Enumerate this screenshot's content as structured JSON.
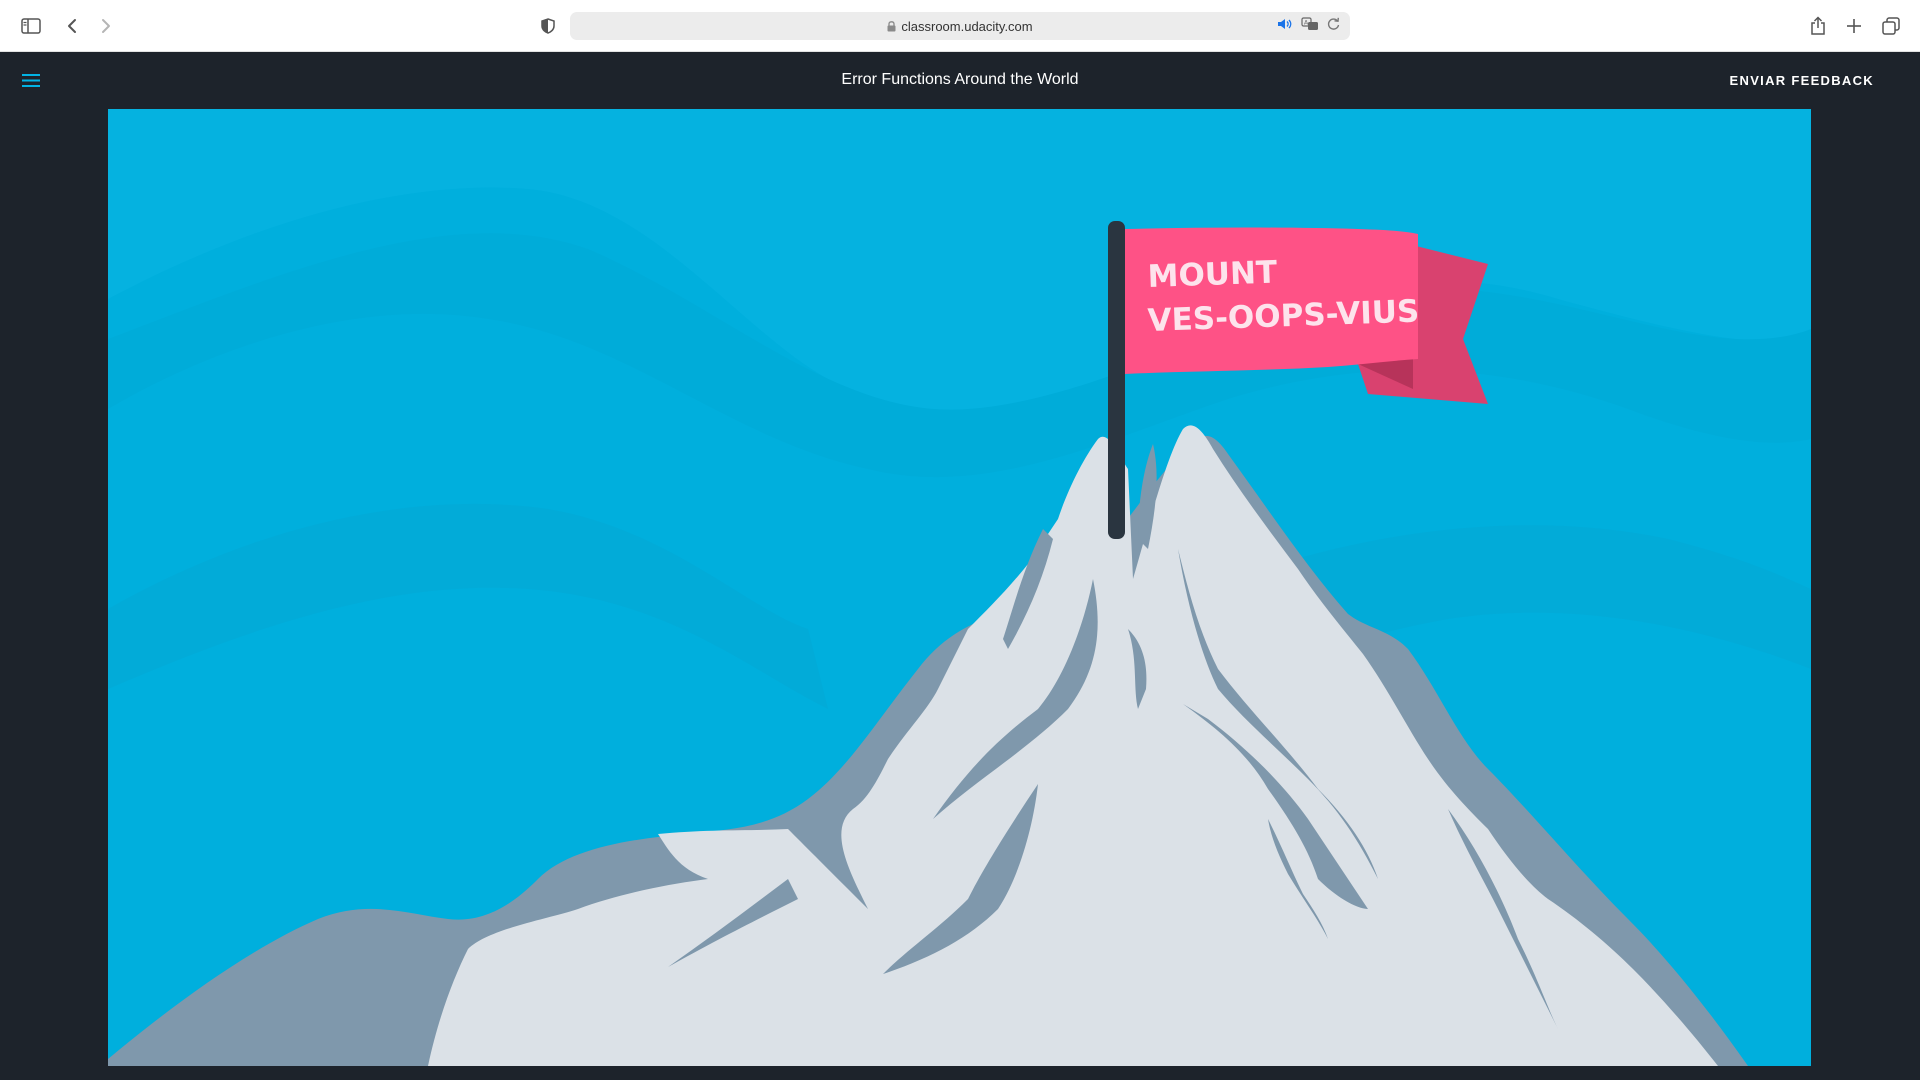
{
  "browser": {
    "url": "classroom.udacity.com",
    "icons": {
      "sidebar": "sidebar-icon",
      "back": "chevron-left-icon",
      "forward": "chevron-right-icon",
      "privacy": "shield-icon",
      "lock": "lock-icon",
      "audio": "speaker-icon",
      "translate": "translate-icon",
      "reload": "reload-icon",
      "share": "share-icon",
      "new_tab": "plus-icon",
      "tabs": "tab-overview-icon"
    }
  },
  "header": {
    "title": "Error Functions Around the World",
    "feedback_label": "ENVIAR FEEDBACK",
    "menu_icon": "hamburger-menu-icon"
  },
  "illustration": {
    "flag_line1": "MOUNT",
    "flag_line2": "VES-OOPS-VIUS"
  },
  "colors": {
    "sky": "#00afdd",
    "mountain_rock": "#7f98ac",
    "snow": "#dbe1e7",
    "flag": "#fe5286",
    "flag_tail": "#d9426f",
    "pole": "#2a3540",
    "header_bg": "#1d232b",
    "accent": "#02b3e4"
  }
}
